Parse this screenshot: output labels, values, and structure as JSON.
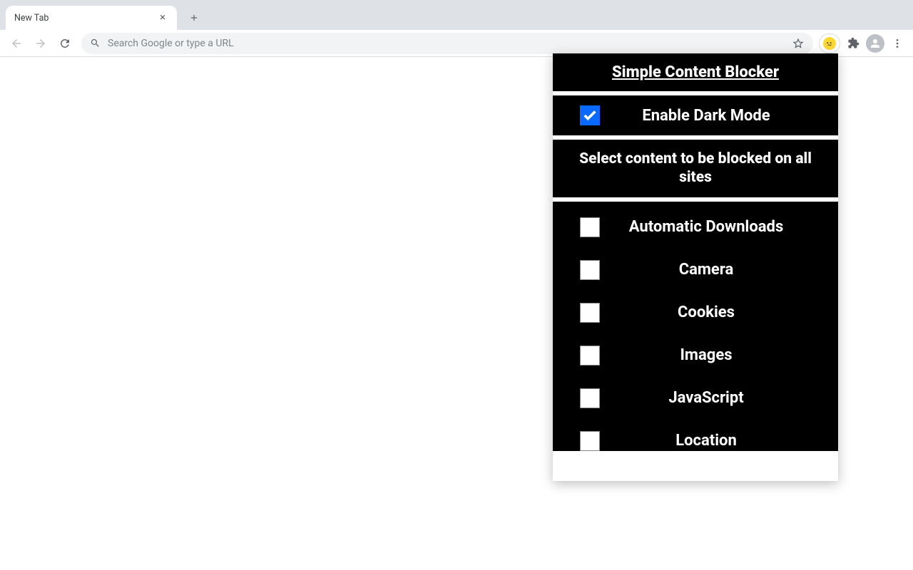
{
  "browser": {
    "tab_title": "New Tab",
    "omnibox_placeholder": "Search Google or type a URL"
  },
  "popup": {
    "title": "Simple Content Blocker",
    "dark_mode": {
      "label": "Enable Dark Mode",
      "checked": true
    },
    "section_title": "Select content to be blocked on all sites",
    "options": [
      {
        "label": "Automatic Downloads",
        "checked": false
      },
      {
        "label": "Camera",
        "checked": false
      },
      {
        "label": "Cookies",
        "checked": false
      },
      {
        "label": "Images",
        "checked": false
      },
      {
        "label": "JavaScript",
        "checked": false
      },
      {
        "label": "Location",
        "checked": false
      }
    ]
  }
}
